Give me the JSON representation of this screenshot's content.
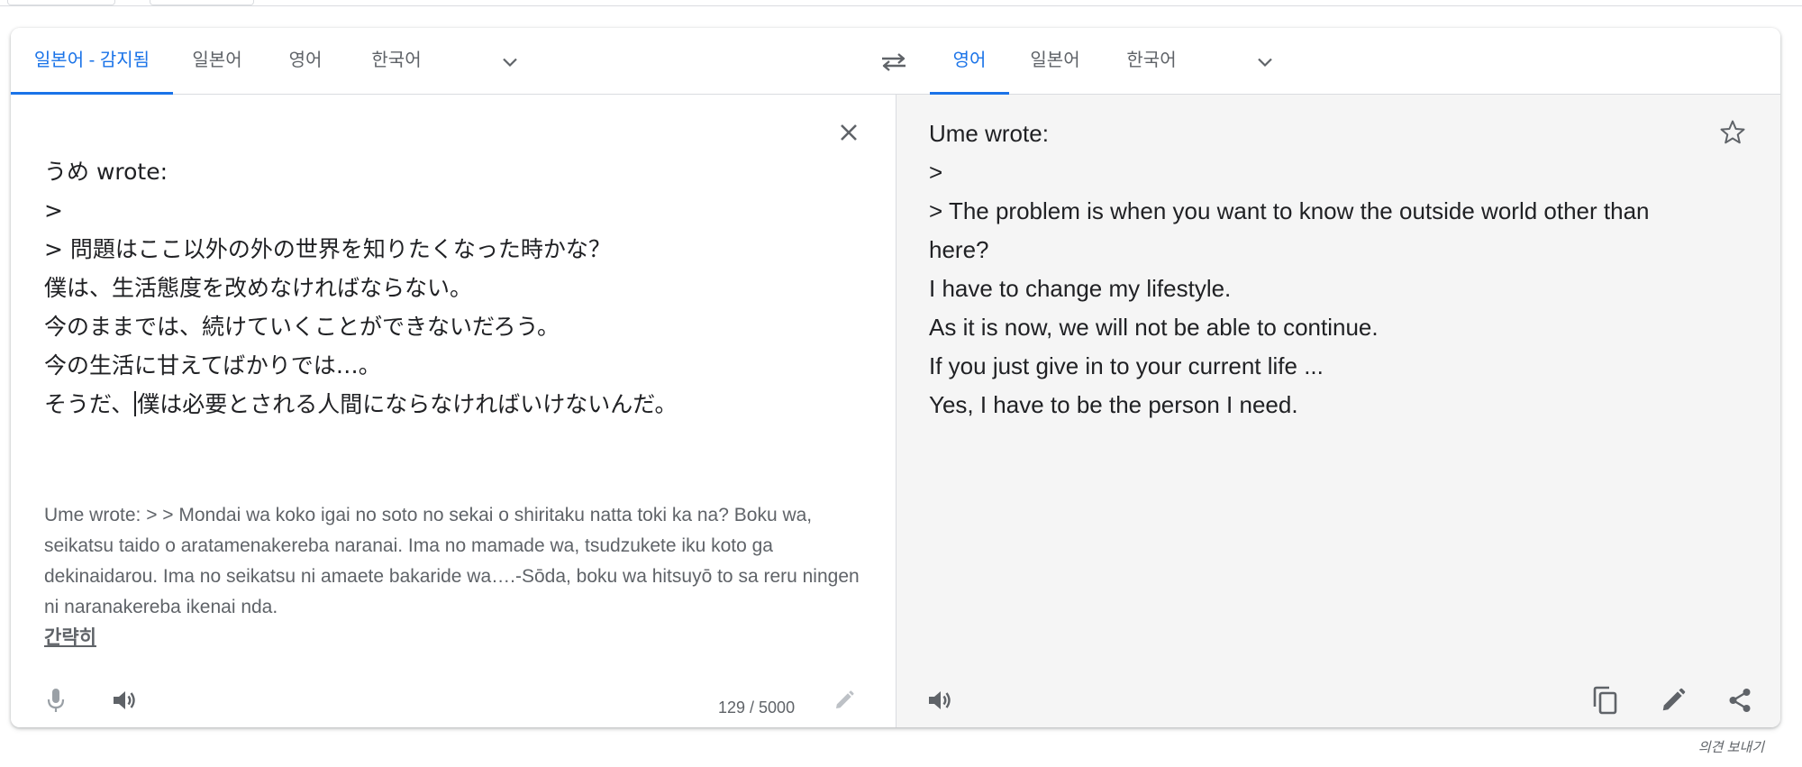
{
  "source_tabs": [
    {
      "label": "일본어 - 감지됨",
      "active": true
    },
    {
      "label": "일본어",
      "active": false
    },
    {
      "label": "영어",
      "active": false
    },
    {
      "label": "한국어",
      "active": false
    }
  ],
  "target_tabs": [
    {
      "label": "영어",
      "active": true
    },
    {
      "label": "일본어",
      "active": false
    },
    {
      "label": "한국어",
      "active": false
    }
  ],
  "source": {
    "lines": [
      "うめ wrote:",
      ">",
      "> 問題はここ以外の外の世界を知りたくなった時かな？",
      "",
      "僕は、生活態度を改めなければならない。",
      "今のままでは、続けていくことができないだろう。",
      "今の生活に甘えてばかりでは…。"
    ],
    "last_line_before_cursor": "そうだ、",
    "last_line_after_cursor": "僕は必要とされる人間にならなければいけないんだ。",
    "romanization": "Ume wrote: > > Mondai wa koko igai no soto no sekai o shiritaku natta toki ka na? Boku wa, seikatsu taido o aratamenakereba naranai. Ima no mamade wa, tsudzukete iku koto ga dekinaidarou. Ima no seikatsu ni amaete bakaride wa….-Sōda, boku wa hitsuyō to sa reru ningen ni naranakereba ikenai nda.",
    "simplify_label": "간략히",
    "char_count": "129 / 5000"
  },
  "target": {
    "lines": [
      "Ume wrote:",
      ">",
      "> The problem is when you want to know the outside world other than",
      "here?",
      "",
      "I have to change my lifestyle.",
      "As it is now, we will not be able to continue.",
      "If you just give in to your current life ...",
      "Yes, I have to be the person I need."
    ]
  },
  "feedback_label": "의견 보내기",
  "icons": {
    "dropdown": "chevron-down-icon",
    "swap": "swap-languages-icon",
    "clear": "close-icon",
    "mic": "microphone-icon",
    "speaker": "speaker-icon",
    "edit": "pencil-icon",
    "star": "star-icon",
    "copy": "copy-icon",
    "share": "share-icon"
  },
  "colors": {
    "accent": "#1a73e8",
    "muted_text": "#5f6368",
    "translation_bg": "#f5f5f5"
  }
}
